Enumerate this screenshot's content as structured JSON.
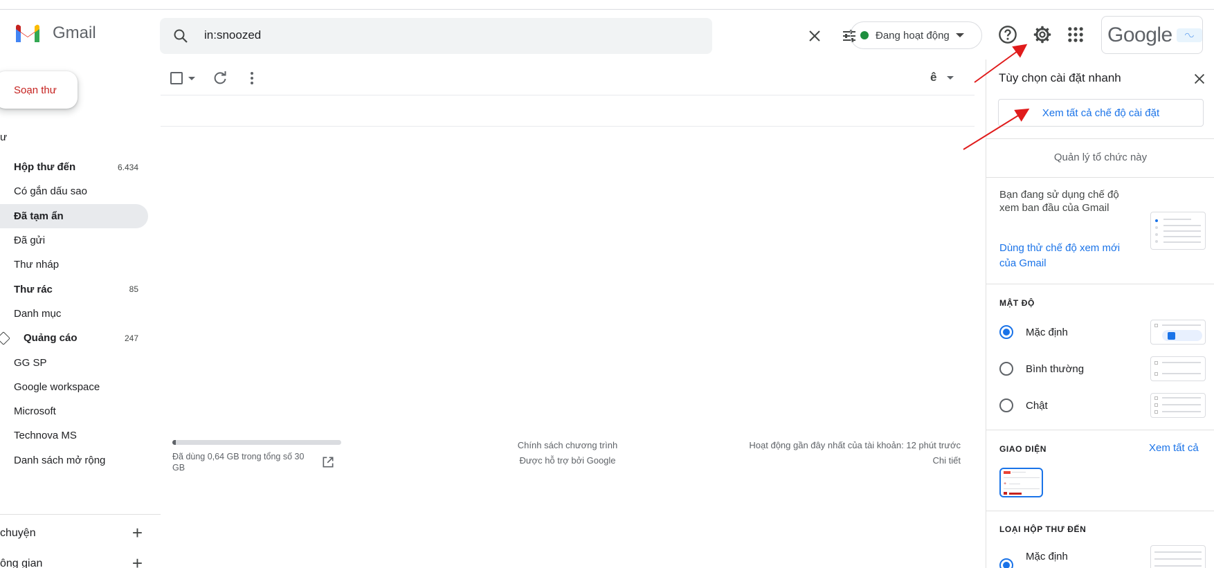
{
  "app": {
    "name": "Gmail"
  },
  "search": {
    "query": "in:snoozed"
  },
  "status": {
    "label": "Đang hoạt động",
    "color": "#1e8e3e"
  },
  "header": {
    "google_word": "Google",
    "icons": [
      "help-icon",
      "settings-icon",
      "apps-grid-icon"
    ]
  },
  "compose": {
    "label": "Soạn thư"
  },
  "nav": {
    "section_stub": "ư",
    "items": [
      {
        "label": "Hộp thư đến",
        "count": "6.434",
        "bold": true
      },
      {
        "label": "Có gắn dấu sao",
        "count": "",
        "bold": false
      },
      {
        "label": "Đã tạm ẩn",
        "count": "",
        "bold": true,
        "active": true
      },
      {
        "label": "Đã gửi",
        "count": "",
        "bold": false
      },
      {
        "label": "Thư nháp",
        "count": "",
        "bold": false
      },
      {
        "label": "Thư rác",
        "count": "85",
        "bold": true
      },
      {
        "label": "Danh mục",
        "count": "",
        "bold": false
      },
      {
        "label": "Quảng cáo",
        "count": "247",
        "bold": true,
        "label_item": true
      },
      {
        "label": "GG SP",
        "count": "",
        "bold": false
      },
      {
        "label": "Google workspace",
        "count": "",
        "bold": false
      },
      {
        "label": "Microsoft",
        "count": "",
        "bold": false
      },
      {
        "label": "Technova MS",
        "count": "",
        "bold": false
      },
      {
        "label": "Danh sách mở rộng",
        "count": "",
        "bold": false
      }
    ],
    "chat_label": "chuyện",
    "spaces_label": "ông gian"
  },
  "toolbar": {
    "lang_label": "ê"
  },
  "footer": {
    "storage_text": "Đã dùng 0,64 GB trong tổng số 30 GB",
    "storage_fraction": 0.02,
    "policy": "Chính sách chương trình",
    "powered": "Được hỗ trợ bởi Google",
    "activity": "Hoạt động gần đây nhất của tài khoản: 12 phút trước",
    "details": "Chi tiết"
  },
  "quick_settings": {
    "title": "Tùy chọn cài đặt nhanh",
    "see_all_settings": "Xem tất cả chế độ cài đặt",
    "manage_org": "Quản lý tổ chức này",
    "view_text": "Bạn đang sử dụng chế độ xem ban đầu của Gmail",
    "view_link": "Dùng thử chế độ xem mới của Gmail",
    "density_heading": "MẬT ĐỘ",
    "density_options": [
      {
        "label": "Mặc định",
        "selected": true
      },
      {
        "label": "Bình thường",
        "selected": false
      },
      {
        "label": "Chật",
        "selected": false
      }
    ],
    "theme_heading": "GIAO DIỆN",
    "theme_see_all": "Xem tất cả",
    "inbox_heading": "LOẠI HỘP THƯ ĐẾN",
    "inbox_option": "Mặc định"
  },
  "colors": {
    "accent": "#1a73e8",
    "compose_text": "#c5221f",
    "annotation_arrow": "#e01b1b"
  }
}
